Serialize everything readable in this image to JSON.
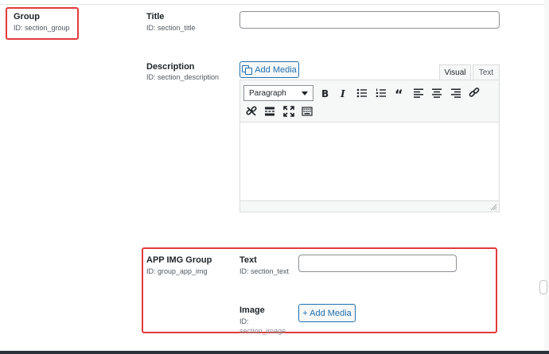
{
  "group": {
    "title": "Group",
    "id": "ID: section_group"
  },
  "title_field": {
    "title": "Title",
    "id": "ID: section_title",
    "value": ""
  },
  "description": {
    "title": "Description",
    "id": "ID: section_description",
    "add_media": "Add Media",
    "tabs": [
      "Visual",
      "Text"
    ],
    "format_select": "Paragraph",
    "toolbar_icons": [
      "bold-icon",
      "italic-icon",
      "bulleted-list-icon",
      "numbered-list-icon",
      "blockquote-icon",
      "align-left-icon",
      "align-center-icon",
      "align-right-icon",
      "insert-link-icon",
      "remove-link-icon",
      "read-more-icon",
      "fullscreen-icon",
      "toolbar-toggle-icon"
    ]
  },
  "app_img_group": {
    "title": "APP IMG Group",
    "id": "ID: group_app_img",
    "text_field": {
      "title": "Text",
      "id": "ID: section_text",
      "value": ""
    },
    "image_field": {
      "title": "Image",
      "id_line1": "ID:",
      "id_line2": "section_image",
      "add_media": "+ Add Media"
    }
  },
  "colors": {
    "highlight": "#e23b3b",
    "accent": "#2271b1"
  }
}
